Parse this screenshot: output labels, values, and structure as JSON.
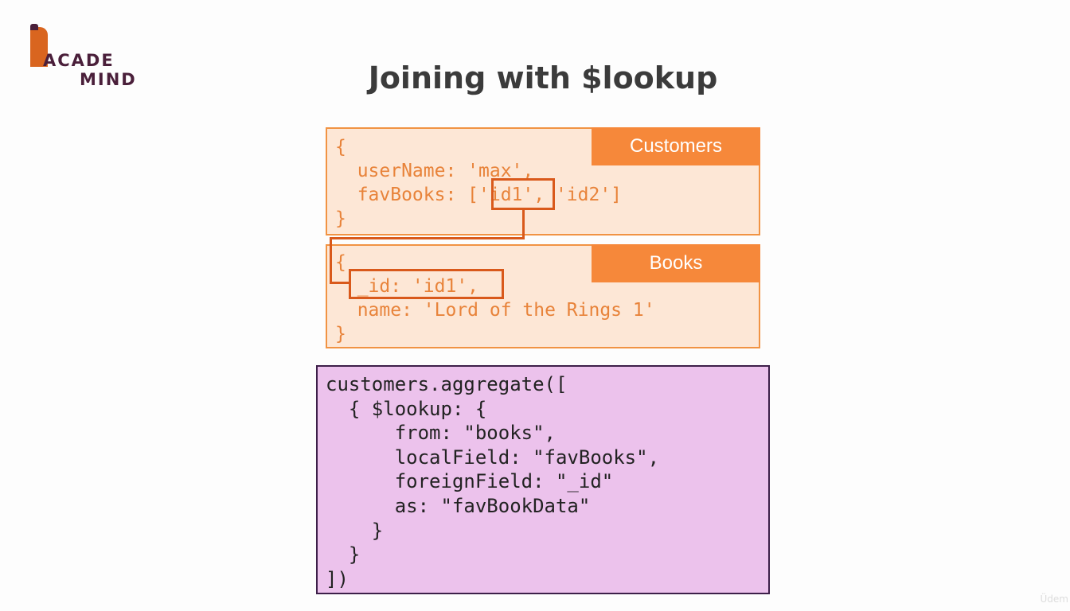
{
  "logo": {
    "line1": "ACADE",
    "line2": "MIND"
  },
  "title": "Joining with $lookup",
  "customers_doc": {
    "tag": "Customers",
    "lines": [
      "{",
      "  userName: 'max',",
      "  favBooks: ['id1', 'id2']",
      "}"
    ]
  },
  "books_doc": {
    "tag": "Books",
    "lines": [
      "{",
      "  _id: 'id1',",
      "  name: 'Lord of the Rings 1'",
      "}"
    ]
  },
  "aggregate_code": {
    "lines": [
      "customers.aggregate([",
      "  { $lookup: {",
      "      from: \"books\",",
      "      localField: \"favBooks\",",
      "      foreignField: \"_id\"",
      "      as: \"favBookData\"",
      "    }",
      "  }",
      "])"
    ]
  },
  "watermark": "Üdem",
  "colors": {
    "accent_orange": "#f6883a",
    "doc_background": "#fde7d6",
    "highlight_border": "#d9591b",
    "aggregate_background": "#ecc2ec",
    "aggregate_border": "#3d1f49",
    "logo_purple": "#4a1f3a"
  }
}
